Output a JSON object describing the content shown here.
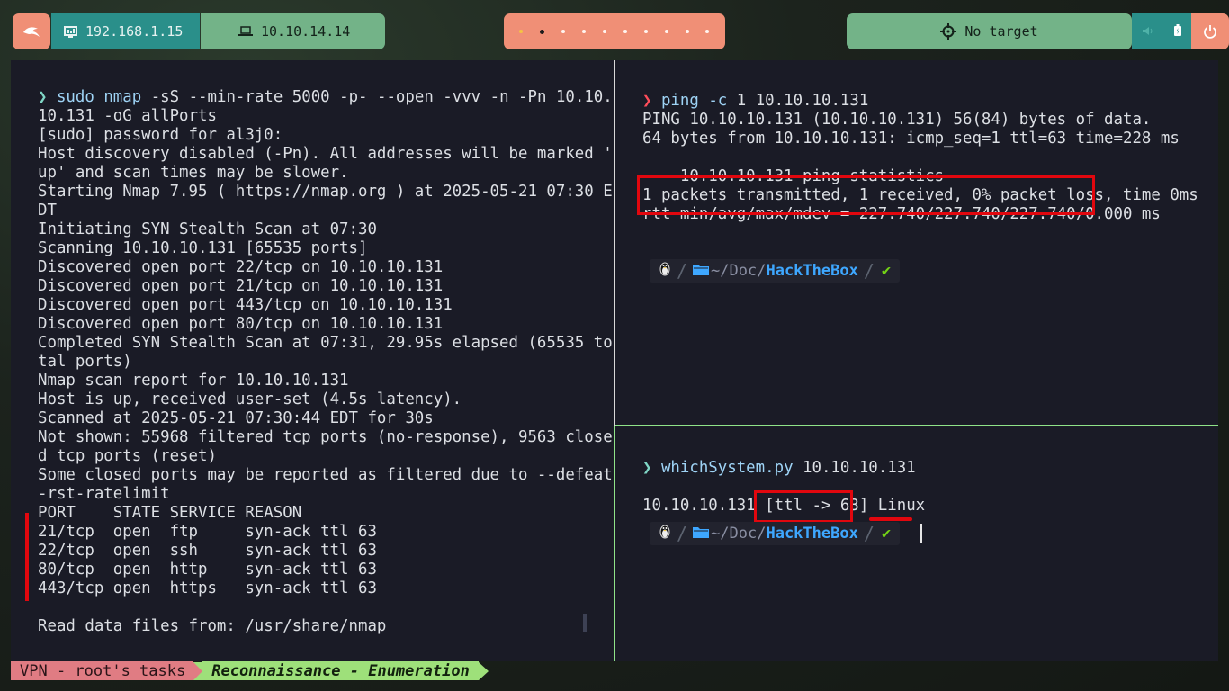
{
  "topbar": {
    "ip_local": "192.168.1.15",
    "ip_vpn": "10.10.14.14",
    "target": "No target",
    "workspaces": [
      1,
      2,
      3,
      4,
      5,
      6,
      7,
      8,
      9,
      10
    ]
  },
  "left_pane": {
    "lines": [
      [
        "prompt",
        "❯ "
      ],
      [
        "u",
        "sudo"
      ],
      [
        "txt",
        " "
      ],
      [
        "cmd",
        "nmap"
      ],
      [
        "txt",
        " -sS --min-rate 5000 -p- --open -vvv -n -Pn 10.10."
      ]
    ],
    "output": [
      "10.131 -oG allPorts",
      "[sudo] password for al3j0:",
      "Host discovery disabled (-Pn). All addresses will be marked '",
      "up' and scan times may be slower.",
      "Starting Nmap 7.95 ( https://nmap.org ) at 2025-05-21 07:30 E",
      "DT",
      "Initiating SYN Stealth Scan at 07:30",
      "Scanning 10.10.10.131 [65535 ports]",
      "Discovered open port 22/tcp on 10.10.10.131",
      "Discovered open port 21/tcp on 10.10.10.131",
      "Discovered open port 443/tcp on 10.10.10.131",
      "Discovered open port 80/tcp on 10.10.10.131",
      "Completed SYN Stealth Scan at 07:31, 29.95s elapsed (65535 to",
      "tal ports)",
      "Nmap scan report for 10.10.10.131",
      "Host is up, received user-set (4.5s latency).",
      "Scanned at 2025-05-21 07:30:44 EDT for 30s",
      "Not shown: 55968 filtered tcp ports (no-response), 9563 close",
      "d tcp ports (reset)",
      "Some closed ports may be reported as filtered due to --defeat",
      "-rst-ratelimit",
      "PORT    STATE SERVICE REASON",
      "21/tcp  open  ftp     syn-ack ttl 63",
      "22/tcp  open  ssh     syn-ack ttl 63",
      "80/tcp  open  http    syn-ack ttl 63",
      "443/tcp open  https   syn-ack ttl 63",
      "",
      "Read data files from: /usr/share/nmap"
    ]
  },
  "right_top": {
    "cmd_name": "ping",
    "cmd_args": " 1 10.10.10.131",
    "cmd_flag": "-c",
    "output": [
      "PING 10.10.10.131 (10.10.10.131) 56(84) bytes of data.",
      "64 bytes from 10.10.10.131: icmp_seq=1 ttl=63 time=228 ms",
      "",
      "--- 10.10.10.131 ping statistics ---",
      "1 packets transmitted, 1 received, 0% packet loss, time 0ms",
      "rtt min/avg/max/mdev = 227.740/227.740/227.740/0.000 ms"
    ]
  },
  "right_bottom": {
    "cmd_name": "whichSystem.py",
    "cmd_args": " 10.10.10.131",
    "result_ip": "10.10.10.131 ",
    "result_ttl": "[ttl -> 63]",
    "result_os": "Linux"
  },
  "ps1": {
    "path_prefix": "~/Doc/",
    "path_dir": "HackTheBox",
    "check": "✔"
  },
  "statusbar": {
    "session": "VPN - root's tasks",
    "window": "Reconnaissance - Enumeration"
  },
  "colors": {
    "highlight": "#e1070e",
    "pane_active_border": "#8fe388",
    "terminal_bg": "#1a1b26"
  }
}
